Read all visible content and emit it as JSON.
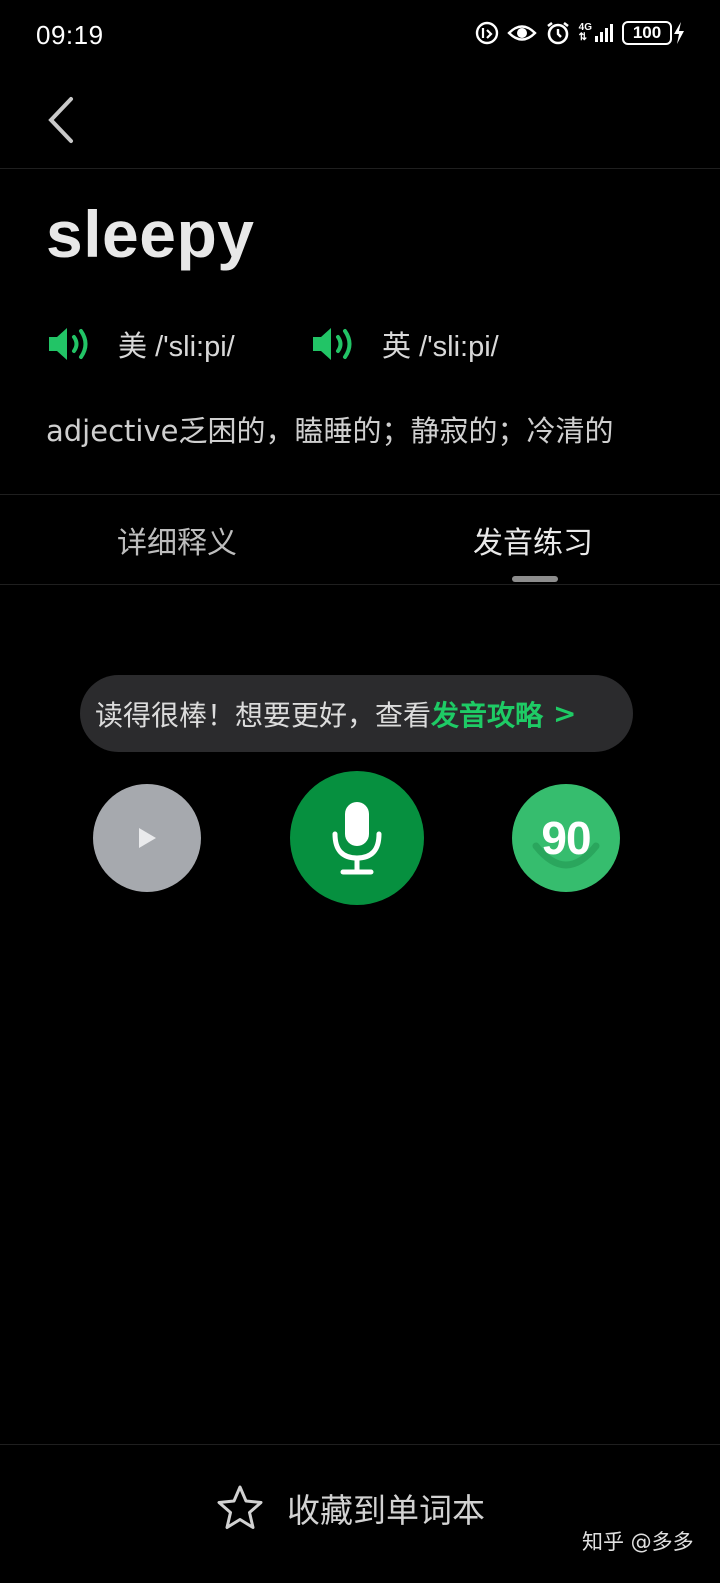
{
  "status_bar": {
    "time": "09:19",
    "network": "4G",
    "battery": "100"
  },
  "word": {
    "title": "sleepy",
    "pronunciations": [
      {
        "region": "美",
        "phonetic": "/'sli:pi/",
        "icon": "speaker-icon"
      },
      {
        "region": "英",
        "phonetic": "/'sli:pi/",
        "icon": "speaker-icon"
      }
    ],
    "definition": "adjective乏困的，瞌睡的；静寂的；冷清的"
  },
  "tabs": [
    {
      "label": "详细释义",
      "active": false
    },
    {
      "label": "发音练习",
      "active": true
    }
  ],
  "tip": {
    "text": "读得很棒！想要更好，查看",
    "link": "发音攻略",
    "arrow": ">"
  },
  "controls": {
    "score": "90"
  },
  "bottom": {
    "collect_label": "收藏到单词本"
  },
  "watermark": "知乎 @多多",
  "colors": {
    "accent_green": "#1ecb65",
    "mic_green": "#06903f",
    "score_green": "#36bd6e",
    "background": "#000000"
  }
}
